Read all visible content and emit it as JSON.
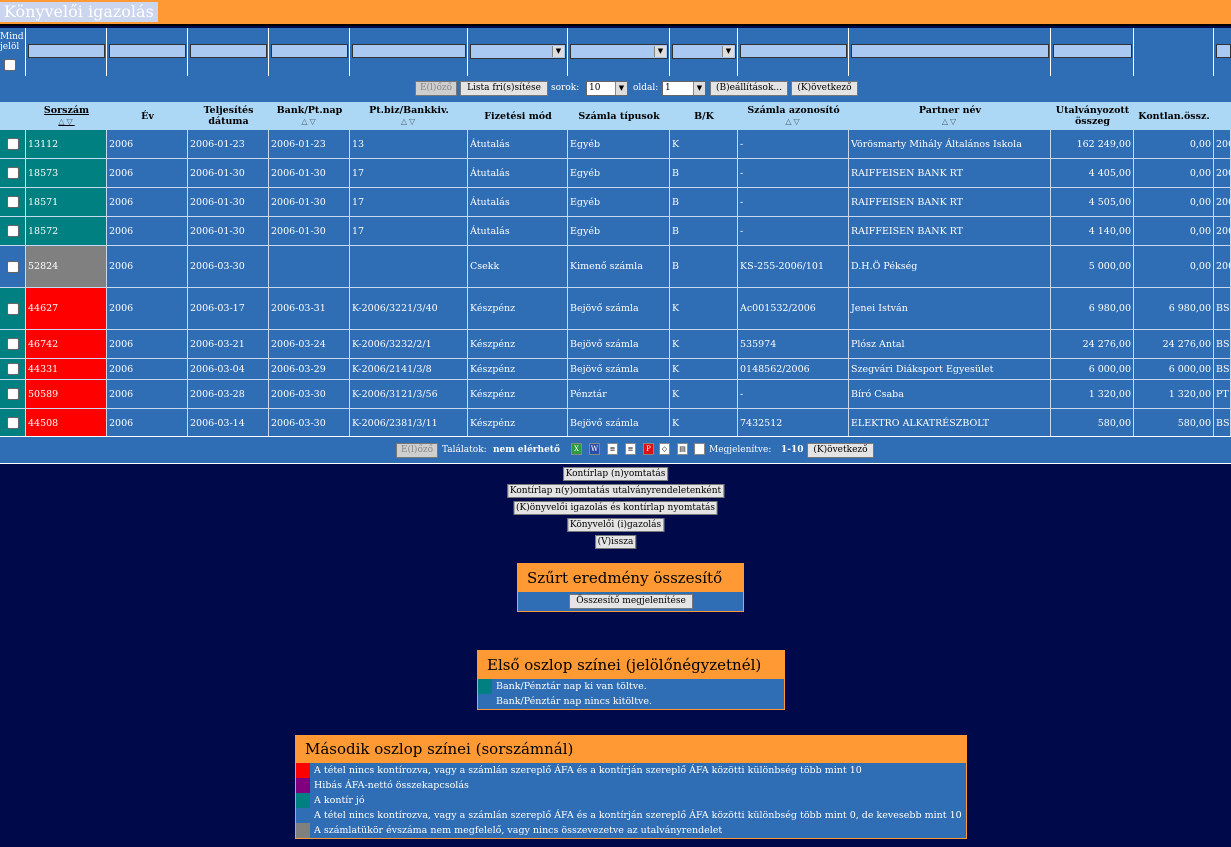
{
  "title": "Könyvelői igazolás",
  "filter": {
    "mind_label": "Mind jelöl",
    "arrow": "▼"
  },
  "pager_top": {
    "prev": "E(l)őző",
    "refresh": "Lista fri(s)sítése",
    "rows_label": "sorok:",
    "rows_value": "10",
    "page_label": "oldal:",
    "page_value": "1",
    "settings": "(B)eállítások...",
    "next": "(K)övetkező"
  },
  "columns": {
    "sorszam": "Sorszám",
    "ev": "Év",
    "teljesites_1": "Teljesítés",
    "teljesites_2": "dátuma",
    "bank": "Bank/Pt.nap",
    "ptbiz": "Pt.biz/Bankkiv.",
    "fizetesi": "Fizetési mód",
    "szamla_tipusok": "Számla típusok",
    "bk": "B/K",
    "szamla_azonosito": "Számla azonosító",
    "partner": "Partner név",
    "utalvanyozott_1": "Utalványozott",
    "utalvanyozott_2": "összeg",
    "kontlan": "Kontlan.össz.",
    "sort_icons": "△▽"
  },
  "rows": [
    {
      "left": "#008080",
      "c2": "#008080",
      "sorszam": "13112",
      "ev": "2006",
      "telj": "2006-01-23",
      "bank": "2006-01-23",
      "ptbiz": "13",
      "fiz": "Átutalás",
      "tipus": "Egyéb",
      "bk": "K",
      "azon": "-",
      "partner": "Vörösmarty Mihály Általános Iskola",
      "utal": "162 249,00",
      "kontlan": "0,00",
      "extra": "200"
    },
    {
      "left": "#008080",
      "c2": "#008080",
      "sorszam": "18573",
      "ev": "2006",
      "telj": "2006-01-30",
      "bank": "2006-01-30",
      "ptbiz": "17",
      "fiz": "Átutalás",
      "tipus": "Egyéb",
      "bk": "B",
      "azon": "-",
      "partner": "RAIFFEISEN BANK RT",
      "utal": "4 405,00",
      "kontlan": "0,00",
      "extra": "200"
    },
    {
      "left": "#008080",
      "c2": "#008080",
      "sorszam": "18571",
      "ev": "2006",
      "telj": "2006-01-30",
      "bank": "2006-01-30",
      "ptbiz": "17",
      "fiz": "Átutalás",
      "tipus": "Egyéb",
      "bk": "B",
      "azon": "-",
      "partner": "RAIFFEISEN BANK RT",
      "utal": "4 505,00",
      "kontlan": "0,00",
      "extra": "200"
    },
    {
      "left": "#008080",
      "c2": "#008080",
      "sorszam": "18572",
      "ev": "2006",
      "telj": "2006-01-30",
      "bank": "2006-01-30",
      "ptbiz": "17",
      "fiz": "Átutalás",
      "tipus": "Egyéb",
      "bk": "B",
      "azon": "-",
      "partner": "RAIFFEISEN BANK RT",
      "utal": "4 140,00",
      "kontlan": "0,00",
      "extra": "200"
    },
    {
      "left": "#2f6db5",
      "c2": "#808080",
      "sorszam": "52824",
      "ev": "2006",
      "telj": "2006-03-30",
      "bank": "",
      "ptbiz": "",
      "fiz": "Csekk",
      "tipus": "Kimenő számla",
      "bk": "B",
      "azon": "KS-255-2006/101",
      "partner": "D.H.Ö Pékség",
      "utal": "5 000,00",
      "kontlan": "0,00",
      "extra": "200"
    },
    {
      "left": "#008080",
      "c2": "#ff0000",
      "sorszam": "44627",
      "ev": "2006",
      "telj": "2006-03-17",
      "bank": "2006-03-31",
      "ptbiz": "K-2006/3221/3/40",
      "fiz": "Készpénz",
      "tipus": "Bejövő számla",
      "bk": "K",
      "azon": "Ac001532/2006",
      "partner": "Jenei István",
      "utal": "6 980,00",
      "kontlan": "6 980,00",
      "extra": "BS-"
    },
    {
      "left": "#008080",
      "c2": "#ff0000",
      "sorszam": "46742",
      "ev": "2006",
      "telj": "2006-03-21",
      "bank": "2006-03-24",
      "ptbiz": "K-2006/3232/2/1",
      "fiz": "Készpénz",
      "tipus": "Bejövő számla",
      "bk": "K",
      "azon": "535974",
      "partner": "Plósz Antal",
      "utal": "24 276,00",
      "kontlan": "24 276,00",
      "extra": "BS-"
    },
    {
      "left": "#008080",
      "c2": "#ff0000",
      "sorszam": "44331",
      "ev": "2006",
      "telj": "2006-03-04",
      "bank": "2006-03-29",
      "ptbiz": "K-2006/2141/3/8",
      "fiz": "Készpénz",
      "tipus": "Bejövő számla",
      "bk": "K",
      "azon": "0148562/2006",
      "partner": "Szegvári Diáksport Egyesület",
      "utal": "6 000,00",
      "kontlan": "6 000,00",
      "extra": "BS-"
    },
    {
      "left": "#008080",
      "c2": "#ff0000",
      "sorszam": "50589",
      "ev": "2006",
      "telj": "2006-03-28",
      "bank": "2006-03-30",
      "ptbiz": "K-2006/3121/3/56",
      "fiz": "Készpénz",
      "tipus": "Pénztár",
      "bk": "K",
      "azon": "-",
      "partner": "Bíró Csaba",
      "utal": "1 320,00",
      "kontlan": "1 320,00",
      "extra": "PT"
    },
    {
      "left": "#008080",
      "c2": "#ff0000",
      "sorszam": "44508",
      "ev": "2006",
      "telj": "2006-03-14",
      "bank": "2006-03-30",
      "ptbiz": "K-2006/2381/3/11",
      "fiz": "Készpénz",
      "tipus": "Bejövő számla",
      "bk": "K",
      "azon": "7432512",
      "partner": "ELEKTRO ALKATRÉSZBOLT",
      "utal": "580,00",
      "kontlan": "580,00",
      "extra": "BS-"
    }
  ],
  "pager_bottom": {
    "prev": "E(l)őző",
    "found_label": "Találatok:",
    "found_value": "nem elérhető",
    "shown_label": "Megjelenítve:",
    "shown_value": "1-10",
    "next": "(K)övetkező"
  },
  "actions": [
    "Kontírlap (n)yomtatás",
    "Kontírlap n(y)omtatás utalványrendeletenként",
    "(K)önyvelői igazolás és kontírlap nyomtatás",
    "Könyvelői (i)gazolás",
    "(V)issza"
  ],
  "summary": {
    "title": "Szűrt eredmény összesítő",
    "button": "Összesítő megjelenítése"
  },
  "legend1": {
    "title": "Első oszlop színei (jelölőnégyzetnél)",
    "items": [
      {
        "color": "#008080",
        "text": "Bank/Pénztár nap ki van töltve."
      },
      {
        "color": "#2f6db5",
        "text": "Bank/Pénztár nap nincs kitöltve."
      }
    ]
  },
  "legend2": {
    "title": "Második oszlop színei (sorszámnál)",
    "items": [
      {
        "color": "#ff0000",
        "text": "A tétel nincs kontírozva, vagy a számlán szereplő ÁFA és a kontírján szereplő ÁFA közötti különbség több mint 10"
      },
      {
        "color": "#800080",
        "text": "Hibás ÁFA-nettó összekapcsolás"
      },
      {
        "color": "#008080",
        "text": "A kontír jó"
      },
      {
        "color": "#2f6db5",
        "text": "A tétel nincs kontírozva, vagy a számlán szereplő ÁFA és a kontírján szereplő ÁFA közötti különbség több mint 0, de kevesebb mint 10"
      },
      {
        "color": "#808080",
        "text": "A számlatükör évszáma nem megfelelő, vagy nincs összevezetve az utalványrendelet"
      }
    ]
  }
}
